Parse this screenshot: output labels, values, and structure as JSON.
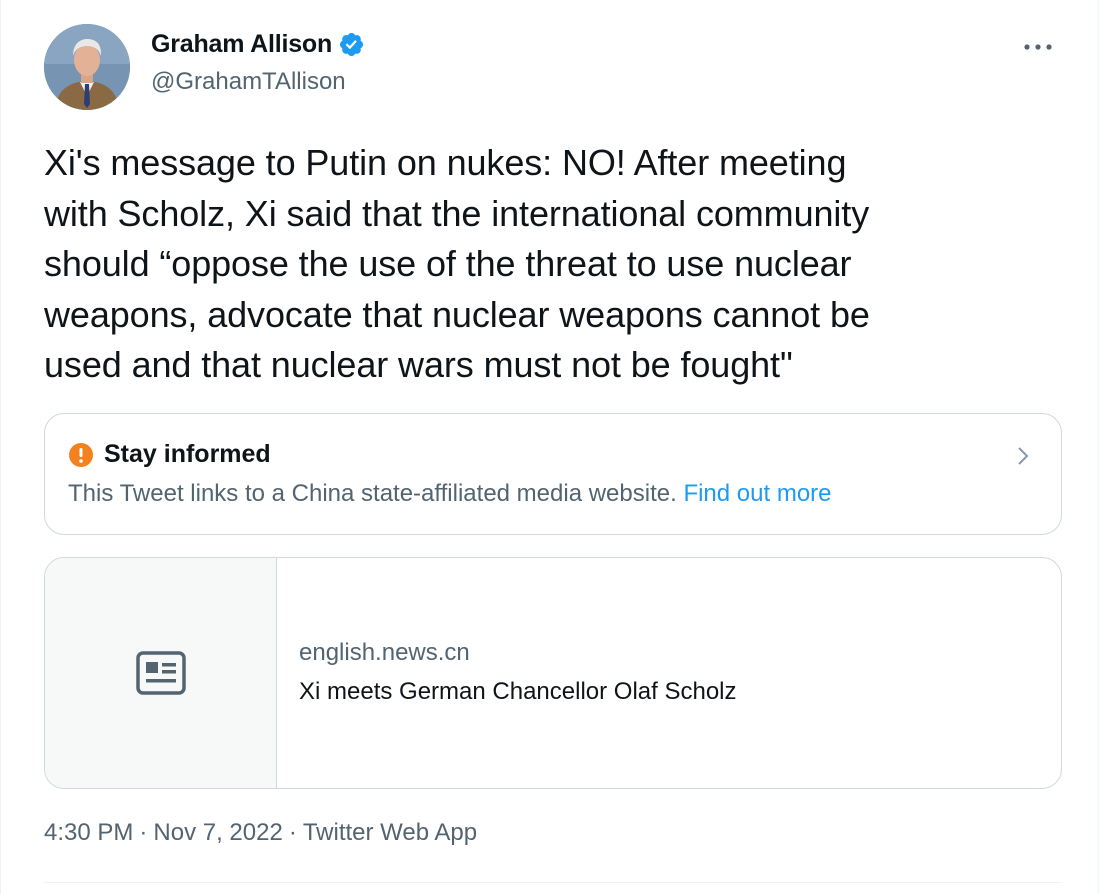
{
  "author": {
    "display_name": "Graham Allison",
    "handle": "@GrahamTAllison",
    "verified": true,
    "avatar_icon": "profile-photo"
  },
  "tweet": {
    "text": "Xi's message to Putin on nukes: NO! After meeting\nwith Scholz, Xi said that the international community\nshould “oppose the use of the threat to use nuclear\nweapons, advocate that nuclear weapons cannot be\nused and that nuclear wars must not be fought\""
  },
  "notice": {
    "title": "Stay informed",
    "body": "This Tweet links to a China state-affiliated media website.",
    "link_text": "Find out more",
    "icon": "alert-icon",
    "icon_color": "#f4811f"
  },
  "link_card": {
    "domain": "english.news.cn",
    "title": "Xi meets German Chancellor Olaf Scholz",
    "icon": "news-icon"
  },
  "meta": {
    "time": "4:30 PM",
    "date": "Nov 7, 2022",
    "source": "Twitter Web App",
    "separator": "·"
  },
  "colors": {
    "accent": "#1d9bf0",
    "secondary_text": "#536471",
    "primary_text": "#0f1419",
    "border": "#cfd9de"
  }
}
